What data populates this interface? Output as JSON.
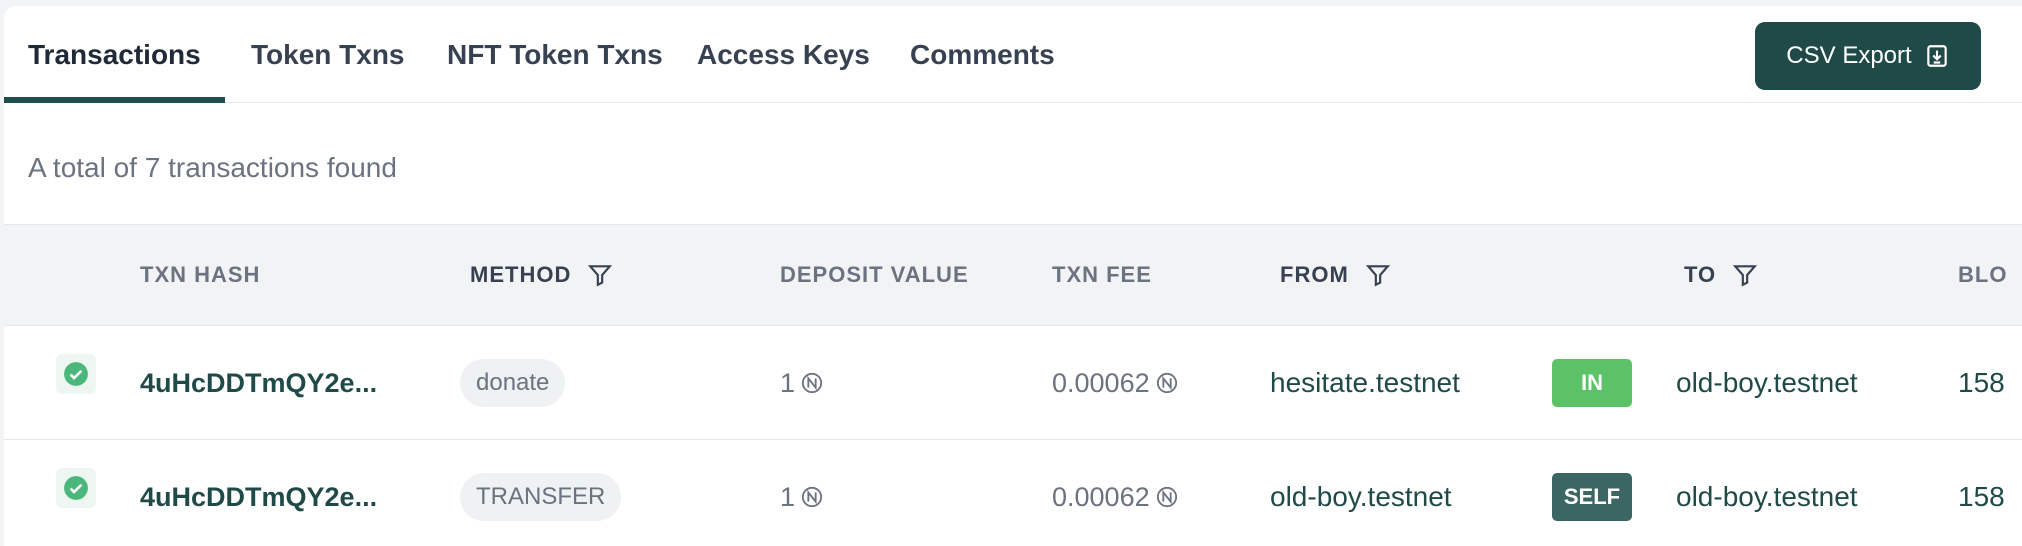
{
  "tabs": [
    {
      "label": "Transactions"
    },
    {
      "label": "Token Txns"
    },
    {
      "label": "NFT Token Txns"
    },
    {
      "label": "Access Keys"
    },
    {
      "label": "Comments"
    }
  ],
  "csv_button": {
    "label": "CSV Export",
    "icon": "download-icon"
  },
  "summary": "A total of 7 transactions found",
  "table": {
    "headers": {
      "txn_hash": "TXN HASH",
      "method": "METHOD",
      "deposit_value": "DEPOSIT VALUE",
      "txn_fee": "TXN FEE",
      "from": "FROM",
      "to": "TO",
      "block": "BLO"
    },
    "rows": [
      {
        "status_icon": "success-check-icon",
        "hash": "4uHcDDTmQY2e...",
        "method": "donate",
        "deposit": "1",
        "fee": "0.00062",
        "from": "hesitate.testnet",
        "direction": "IN",
        "to": "old-boy.testnet",
        "block": "158"
      },
      {
        "status_icon": "success-check-icon",
        "hash": "4uHcDDTmQY2e...",
        "method": "TRANSFER",
        "deposit": "1",
        "fee": "0.00062",
        "from": "old-boy.testnet",
        "direction": "SELF",
        "to": "old-boy.testnet",
        "block": "158"
      }
    ]
  },
  "colors": {
    "primary": "#1f4a48",
    "in_badge": "#5cc267",
    "self_badge": "#3b6664",
    "success": "#4cb77a"
  }
}
